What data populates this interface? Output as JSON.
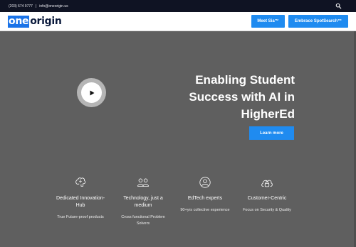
{
  "topbar": {
    "phone": "(203) 674 9777",
    "separator": "|",
    "email": "info@oneorigin.us"
  },
  "header": {
    "logo_part1": "one",
    "logo_part2": "origin",
    "buttons": {
      "meet": "Meet Sia™",
      "embrace": "Embrace SpotSearch™"
    }
  },
  "hero": {
    "title_line1": "Enabling Student",
    "title_line2": "Success with AI in",
    "title_line3": "HigherEd",
    "cta": "Learn more"
  },
  "features": [
    {
      "icon": "brain-icon",
      "title": "Dedicated Innovation-Hub",
      "desc": "True Future-proof products"
    },
    {
      "icon": "team-icon",
      "title": "Technology, just a medium",
      "desc": "Cross functional Problem Solvers"
    },
    {
      "icon": "expert-icon",
      "title": "EdTech experts",
      "desc": "90+yrs collective experience"
    },
    {
      "icon": "security-icon",
      "title": "Customer-Centric",
      "desc": "Focus on Security & Quality"
    }
  ],
  "colors": {
    "accent": "#1f8bf0",
    "logo_blue": "#1a73e8",
    "topbar_bg": "#0f1323",
    "hero_bg": "#5f5f5f"
  }
}
